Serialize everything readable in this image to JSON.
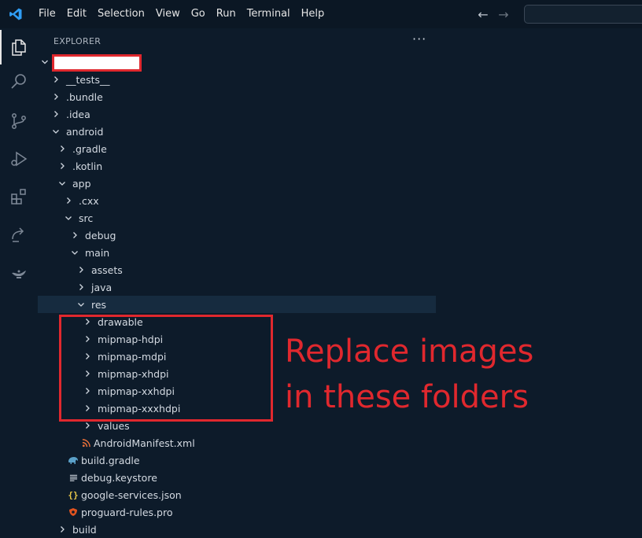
{
  "menu": {
    "items": [
      "File",
      "Edit",
      "Selection",
      "View",
      "Go",
      "Run",
      "Terminal",
      "Help"
    ]
  },
  "explorer": {
    "header": "EXPLORER",
    "more_actions": "···"
  },
  "tree": [
    {
      "label": "__tests__",
      "type": "folder",
      "expanded": false,
      "depth": 1
    },
    {
      "label": ".bundle",
      "type": "folder",
      "expanded": false,
      "depth": 1
    },
    {
      "label": ".idea",
      "type": "folder",
      "expanded": false,
      "depth": 1
    },
    {
      "label": "android",
      "type": "folder",
      "expanded": true,
      "depth": 1
    },
    {
      "label": ".gradle",
      "type": "folder",
      "expanded": false,
      "depth": 2
    },
    {
      "label": ".kotlin",
      "type": "folder",
      "expanded": false,
      "depth": 2
    },
    {
      "label": "app",
      "type": "folder",
      "expanded": true,
      "depth": 2
    },
    {
      "label": ".cxx",
      "type": "folder",
      "expanded": false,
      "depth": 3
    },
    {
      "label": "src",
      "type": "folder",
      "expanded": true,
      "depth": 3
    },
    {
      "label": "debug",
      "type": "folder",
      "expanded": false,
      "depth": 4
    },
    {
      "label": "main",
      "type": "folder",
      "expanded": true,
      "depth": 4
    },
    {
      "label": "assets",
      "type": "folder",
      "expanded": false,
      "depth": 5
    },
    {
      "label": "java",
      "type": "folder",
      "expanded": false,
      "depth": 5
    },
    {
      "label": "res",
      "type": "folder",
      "expanded": true,
      "depth": 5,
      "selected": true
    },
    {
      "label": "drawable",
      "type": "folder",
      "expanded": false,
      "depth": 6
    },
    {
      "label": "mipmap-hdpi",
      "type": "folder",
      "expanded": false,
      "depth": 6
    },
    {
      "label": "mipmap-mdpi",
      "type": "folder",
      "expanded": false,
      "depth": 6
    },
    {
      "label": "mipmap-xhdpi",
      "type": "folder",
      "expanded": false,
      "depth": 6
    },
    {
      "label": "mipmap-xxhdpi",
      "type": "folder",
      "expanded": false,
      "depth": 6
    },
    {
      "label": "mipmap-xxxhdpi",
      "type": "folder",
      "expanded": false,
      "depth": 6
    },
    {
      "label": "values",
      "type": "folder",
      "expanded": false,
      "depth": 6
    },
    {
      "label": "AndroidManifest.xml",
      "type": "file",
      "icon": "rss-icon",
      "depth": 5
    },
    {
      "label": "build.gradle",
      "type": "file",
      "icon": "gradle-elephant-icon",
      "depth": 3
    },
    {
      "label": "debug.keystore",
      "type": "file",
      "icon": "lines-icon",
      "depth": 3
    },
    {
      "label": "google-services.json",
      "type": "file",
      "icon": "json-braces-icon",
      "depth": 3
    },
    {
      "label": "proguard-rules.pro",
      "type": "file",
      "icon": "proguard-shield-icon",
      "depth": 3
    },
    {
      "label": "build",
      "type": "folder",
      "expanded": false,
      "depth": 2
    }
  ],
  "annotation": {
    "line1": "Replace images",
    "line2": "in these folders"
  },
  "colors": {
    "background": "#0d1b2a",
    "accent_red": "#e0282e",
    "selected_row": "#162b3f",
    "vscode_blue": "#2f9df4"
  }
}
